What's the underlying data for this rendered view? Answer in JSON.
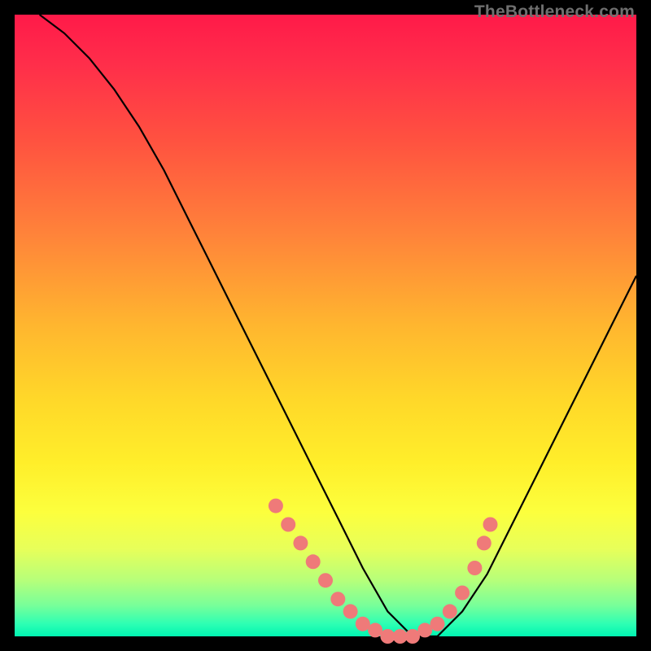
{
  "watermark": "TheBottleneck.com",
  "colors": {
    "dot": "#ef7a79",
    "line": "#000000",
    "frame": "#000000"
  },
  "chart_data": {
    "type": "line",
    "title": "",
    "xlabel": "",
    "ylabel": "",
    "xlim": [
      0,
      100
    ],
    "ylim": [
      0,
      100
    ],
    "grid": false,
    "legend": false,
    "note": "Asymmetric V-shaped bottleneck curve; minimum plateau ≈ x 56–66; left arm steep from top-left, right arm rises toward upper-right. Values estimated from pixel positions on a 0–100 normalized axis.",
    "series": [
      {
        "name": "curve",
        "x": [
          4,
          8,
          12,
          16,
          20,
          24,
          28,
          32,
          36,
          40,
          44,
          48,
          52,
          56,
          60,
          64,
          68,
          72,
          76,
          80,
          84,
          88,
          92,
          96,
          100
        ],
        "y": [
          100,
          97,
          93,
          88,
          82,
          75,
          67,
          59,
          51,
          43,
          35,
          27,
          19,
          11,
          4,
          0,
          0,
          4,
          10,
          18,
          26,
          34,
          42,
          50,
          58
        ]
      }
    ],
    "markers": {
      "name": "dots",
      "x": [
        42,
        44,
        46,
        48,
        50,
        52,
        54,
        56,
        58,
        60,
        62,
        64,
        66,
        68,
        70,
        72,
        74,
        75.5,
        76.5
      ],
      "y": [
        21,
        18,
        15,
        12,
        9,
        6,
        4,
        2,
        1,
        0,
        0,
        0,
        1,
        2,
        4,
        7,
        11,
        15,
        18
      ]
    }
  }
}
